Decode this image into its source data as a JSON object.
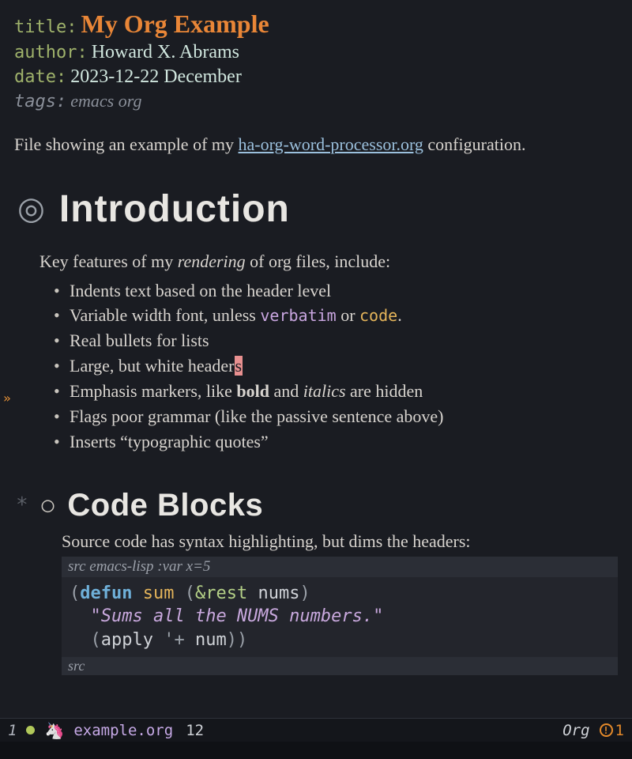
{
  "meta": {
    "title_label": "title:",
    "title_value": "My Org Example",
    "author_label": "author:",
    "author_value": "Howard X. Abrams",
    "date_label": "date:",
    "date_value": "2023-12-22 December",
    "tags_label": "tags:",
    "tags_value": "emacs org"
  },
  "intro_text": {
    "pre": "File showing an example of my ",
    "link": "ha-org-word-processor.org",
    "post": " configuration."
  },
  "h1": {
    "bullet": "◎",
    "text": "Introduction"
  },
  "features": {
    "lead_pre": "Key features of my ",
    "lead_em": "rendering",
    "lead_post": " of org files, include:",
    "items": [
      {
        "text": "Indents text based on the header level"
      },
      {
        "pre": "Variable width font, unless ",
        "verb": "verbatim",
        "mid": " or ",
        "code": "code",
        "post": "."
      },
      {
        "text": "Real bullets for lists"
      },
      {
        "pre": "Large, but white header",
        "cursor": "s"
      },
      {
        "pre": "Emphasis markers, like ",
        "bold": "bold",
        "mid": " and ",
        "ital": "italics",
        "post": " are hidden"
      },
      {
        "text": "Flags poor grammar (like the passive sentence above)"
      },
      {
        "text": "Inserts “typographic quotes”"
      }
    ]
  },
  "h2": {
    "star": "*",
    "bullet": "○",
    "text": "Code Blocks"
  },
  "src": {
    "intro": "Source code has syntax highlighting, but dims the headers:",
    "header": "src emacs-lisp :var x=5",
    "defun": "defun",
    "fname": "sum",
    "amp": "&rest",
    "arg": "nums",
    "docstring": "\"Sums all the NUMS numbers.\"",
    "apply": "apply",
    "plus": "'+",
    "num": "num",
    "footer": "src"
  },
  "modeline": {
    "win": "1",
    "file": "example.org",
    "line": "12",
    "mode": "Org",
    "err_count": "1"
  }
}
